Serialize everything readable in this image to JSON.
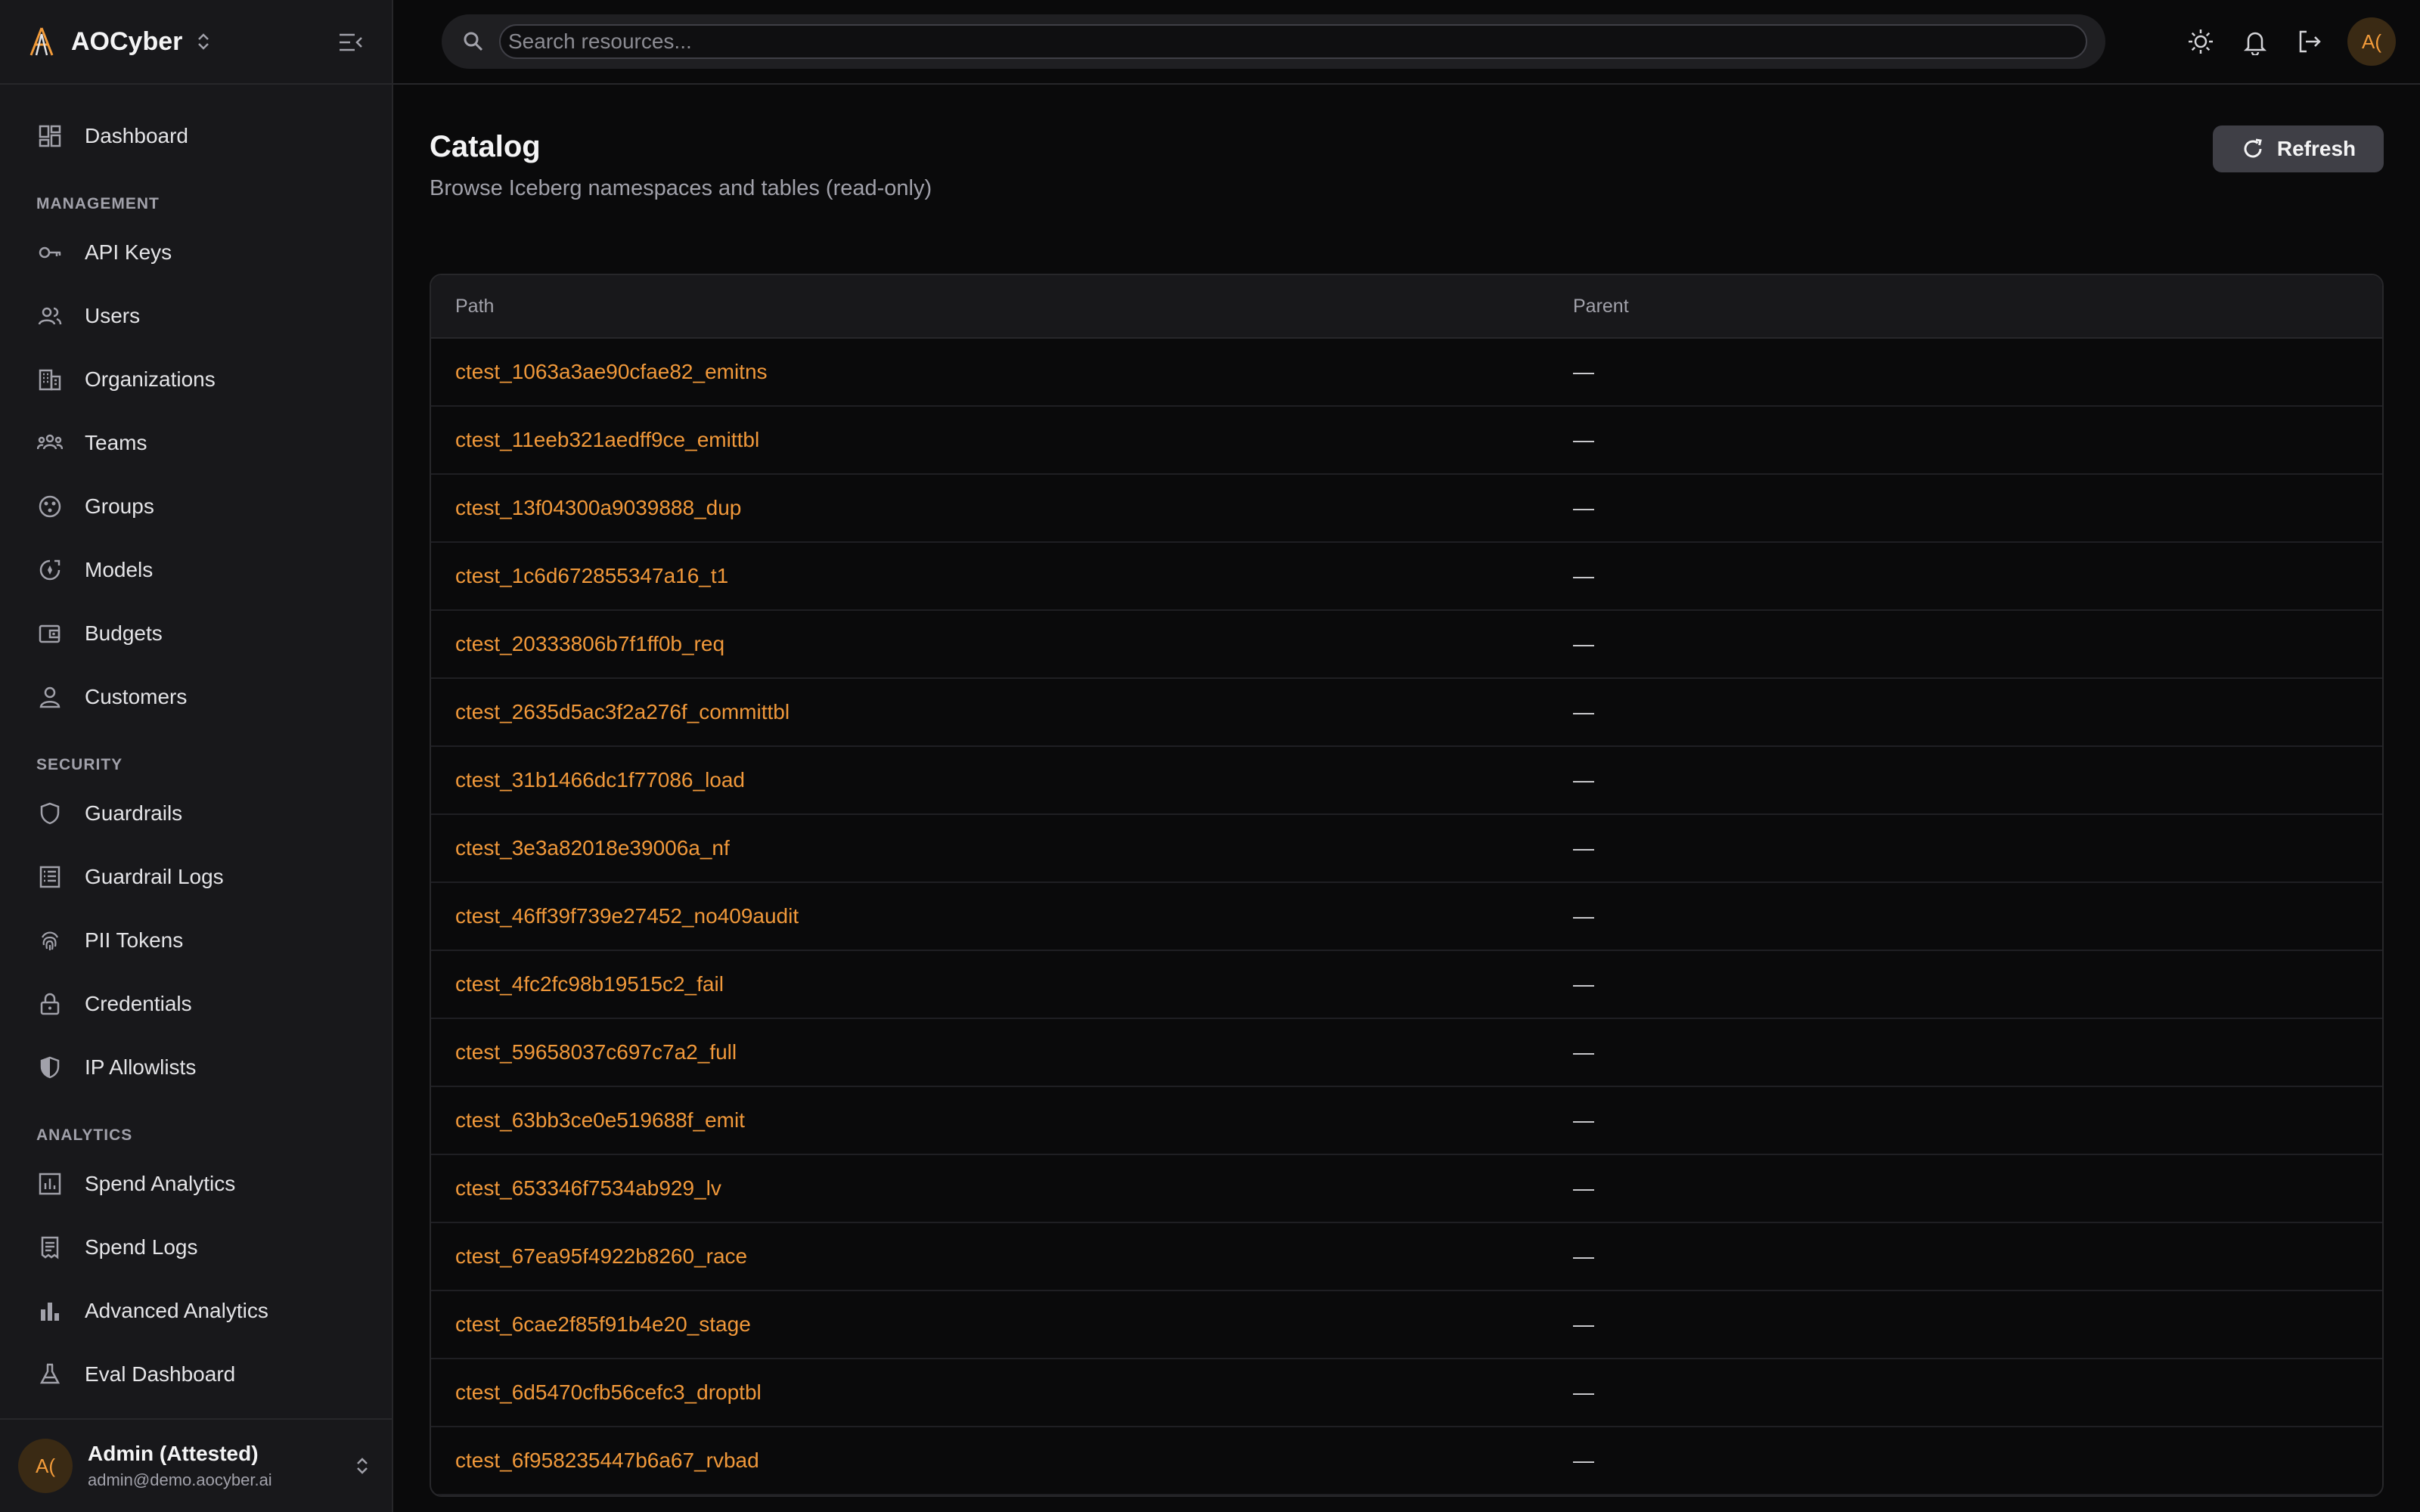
{
  "brand": {
    "name": "AOCyber"
  },
  "sidebar": {
    "dashboard": "Dashboard",
    "sections": [
      {
        "title": "MANAGEMENT",
        "items": [
          {
            "label": "API Keys",
            "icon": "key-icon"
          },
          {
            "label": "Users",
            "icon": "users-icon"
          },
          {
            "label": "Organizations",
            "icon": "building-icon"
          },
          {
            "label": "Teams",
            "icon": "teams-icon"
          },
          {
            "label": "Groups",
            "icon": "groups-icon"
          },
          {
            "label": "Models",
            "icon": "models-icon"
          },
          {
            "label": "Budgets",
            "icon": "wallet-icon"
          },
          {
            "label": "Customers",
            "icon": "person-icon"
          }
        ]
      },
      {
        "title": "SECURITY",
        "items": [
          {
            "label": "Guardrails",
            "icon": "shield-icon"
          },
          {
            "label": "Guardrail Logs",
            "icon": "list-icon"
          },
          {
            "label": "PII Tokens",
            "icon": "fingerprint-icon"
          },
          {
            "label": "Credentials",
            "icon": "lock-icon"
          },
          {
            "label": "IP Allowlists",
            "icon": "shield-half-icon"
          }
        ]
      },
      {
        "title": "ANALYTICS",
        "items": [
          {
            "label": "Spend Analytics",
            "icon": "chart-box-icon"
          },
          {
            "label": "Spend Logs",
            "icon": "receipt-icon"
          },
          {
            "label": "Advanced Analytics",
            "icon": "bar-chart-icon"
          },
          {
            "label": "Eval Dashboard",
            "icon": "flask-icon"
          }
        ]
      }
    ]
  },
  "user": {
    "initials": "A(",
    "name": "Admin (Attested)",
    "email": "admin@demo.aocyber.ai"
  },
  "search": {
    "placeholder": "Search resources..."
  },
  "page": {
    "title": "Catalog",
    "subtitle": "Browse Iceberg namespaces and tables (read-only)",
    "refresh_label": "Refresh"
  },
  "table": {
    "headers": {
      "path": "Path",
      "parent": "Parent"
    },
    "rows": [
      {
        "path": "ctest_1063a3ae90cfae82_emitns",
        "parent": "—"
      },
      {
        "path": "ctest_11eeb321aedff9ce_emittbl",
        "parent": "—"
      },
      {
        "path": "ctest_13f04300a9039888_dup",
        "parent": "—"
      },
      {
        "path": "ctest_1c6d672855347a16_t1",
        "parent": "—"
      },
      {
        "path": "ctest_20333806b7f1ff0b_req",
        "parent": "—"
      },
      {
        "path": "ctest_2635d5ac3f2a276f_committbl",
        "parent": "—"
      },
      {
        "path": "ctest_31b1466dc1f77086_load",
        "parent": "—"
      },
      {
        "path": "ctest_3e3a82018e39006a_nf",
        "parent": "—"
      },
      {
        "path": "ctest_46ff39f739e27452_no409audit",
        "parent": "—"
      },
      {
        "path": "ctest_4fc2fc98b19515c2_fail",
        "parent": "—"
      },
      {
        "path": "ctest_59658037c697c7a2_full",
        "parent": "—"
      },
      {
        "path": "ctest_63bb3ce0e519688f_emit",
        "parent": "—"
      },
      {
        "path": "ctest_653346f7534ab929_lv",
        "parent": "—"
      },
      {
        "path": "ctest_67ea95f4922b8260_race",
        "parent": "—"
      },
      {
        "path": "ctest_6cae2f85f91b4e20_stage",
        "parent": "—"
      },
      {
        "path": "ctest_6d5470cfb56cefc3_droptbl",
        "parent": "—"
      },
      {
        "path": "ctest_6f958235447b6a67_rvbad",
        "parent": "—"
      }
    ]
  },
  "colors": {
    "accent": "#f0983a",
    "bg": "#0a0a0b",
    "sidebar": "#18181b"
  }
}
